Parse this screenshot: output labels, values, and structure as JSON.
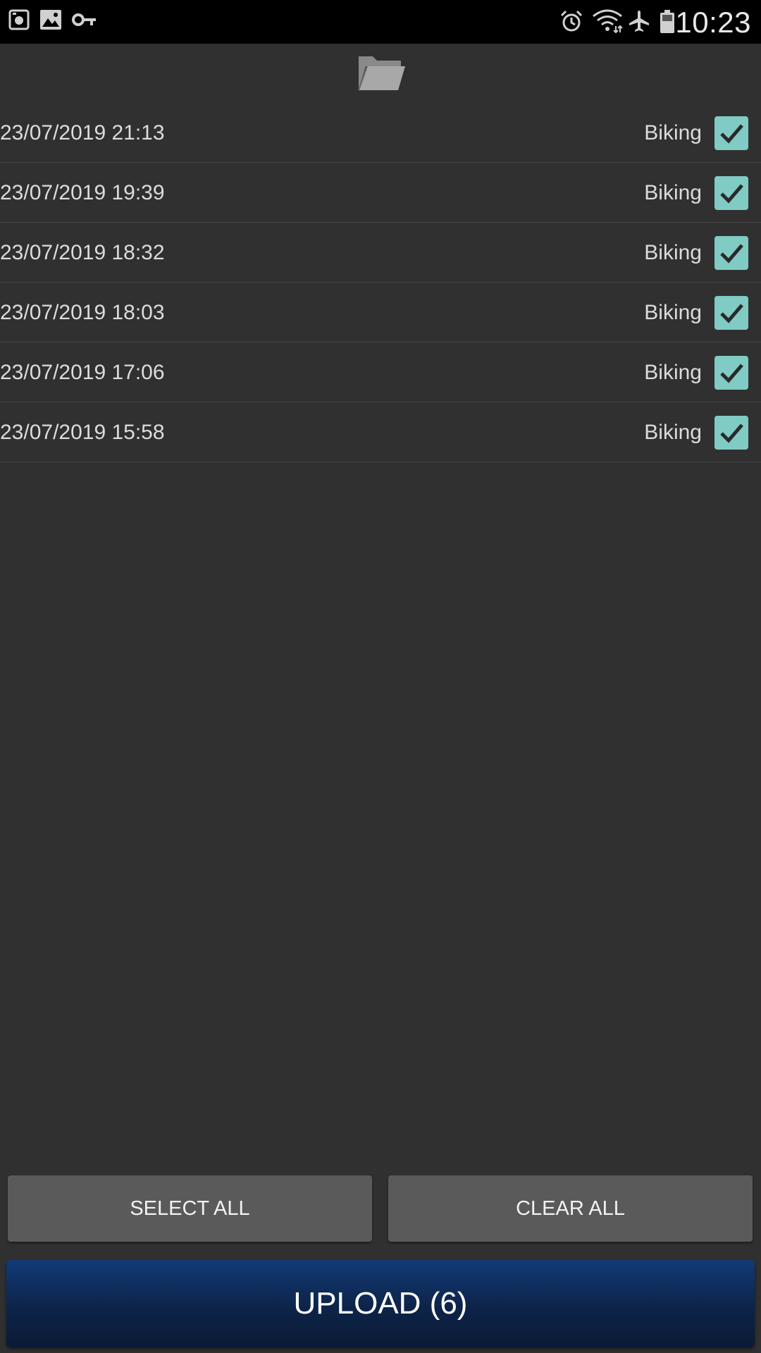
{
  "status_bar": {
    "left_icons": [
      "screenshot-icon",
      "image-icon",
      "vpn-key-icon"
    ],
    "right_icons": [
      "alarm-icon",
      "wifi-icon",
      "airplane-mode-icon",
      "battery-icon"
    ],
    "time": "10:23"
  },
  "toolbar": {
    "folder_icon": "folder-open-icon"
  },
  "entries": [
    {
      "date": "23/07/2019 21:13",
      "activity": "Biking",
      "checked": true
    },
    {
      "date": "23/07/2019 19:39",
      "activity": "Biking",
      "checked": true
    },
    {
      "date": "23/07/2019 18:32",
      "activity": "Biking",
      "checked": true
    },
    {
      "date": "23/07/2019 18:03",
      "activity": "Biking",
      "checked": true
    },
    {
      "date": "23/07/2019 17:06",
      "activity": "Biking",
      "checked": true
    },
    {
      "date": "23/07/2019 15:58",
      "activity": "Biking",
      "checked": true
    }
  ],
  "buttons": {
    "select_all": "SELECT ALL",
    "clear_all": "CLEAR ALL",
    "upload": "UPLOAD (6)"
  },
  "colors": {
    "background": "#303030",
    "checkbox": "#80cbc4",
    "upload_button": "#0d2448",
    "secondary_button": "#5a5a5b"
  }
}
